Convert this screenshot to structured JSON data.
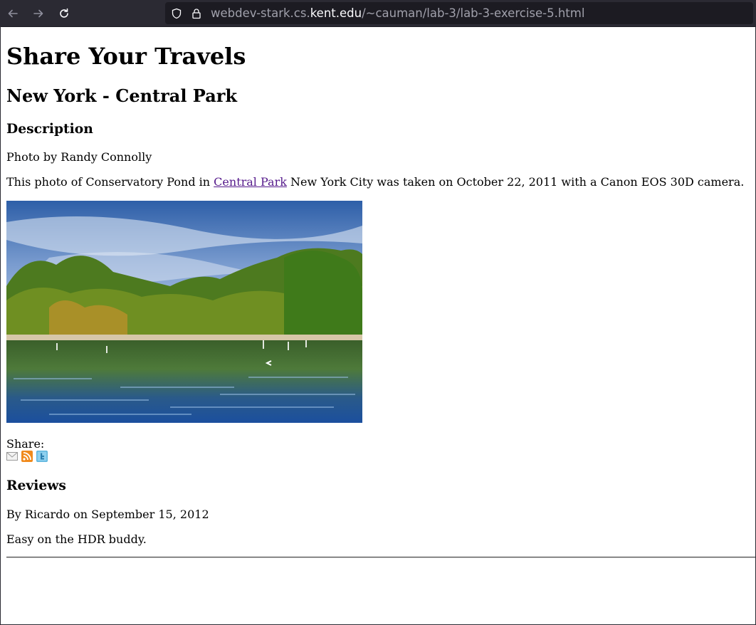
{
  "browser": {
    "url_prefix": "webdev-stark.cs.",
    "url_host": "kent.edu",
    "url_path": "/~cauman/lab-3/lab-3-exercise-5.html"
  },
  "page": {
    "title": "Share Your Travels",
    "subtitle": "New York - Central Park",
    "description_heading": "Description",
    "credit": "Photo by Randy Connolly",
    "body_before_link": "This photo of Conservatory Pond in ",
    "link_text": "Central Park",
    "body_after_link": " New York City was taken on October 22, 2011 with a Canon EOS 30D camera.",
    "share_label": "Share:",
    "share_icons": [
      "email-icon",
      "rss-icon",
      "twitter-icon"
    ],
    "reviews_heading": "Reviews",
    "review_by": "By Ricardo on September 15, 2012",
    "review_text": "Easy on the HDR buddy."
  },
  "colors": {
    "link_visited": "#551a8b",
    "toolbar_bg": "#2b2a33"
  }
}
